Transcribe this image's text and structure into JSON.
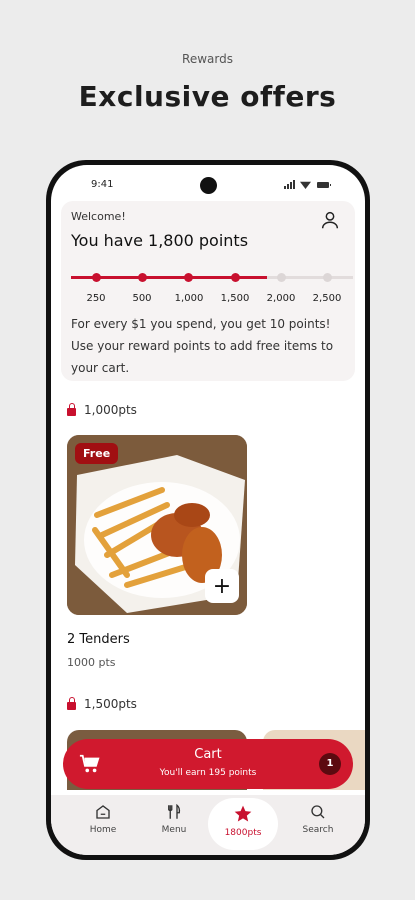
{
  "promo": {
    "eyebrow": "Rewards",
    "headline": "Exclusive offers"
  },
  "status_bar": {
    "time": "9:41"
  },
  "rewards_card": {
    "welcome": "Welcome!",
    "points_text": "You have 1,800 points",
    "progress": {
      "current_points": 1800,
      "reached_dots": 4,
      "total_dots": 6
    },
    "tick_labels": [
      "250",
      "500",
      "1,000",
      "1,500",
      "2,000",
      "2,500"
    ],
    "description": "For every $1 you spend, you get 10 points! Use your reward points to add free items to your cart."
  },
  "tiers": [
    {
      "label": "1,000pts",
      "items": [
        {
          "badge": "Free",
          "name": "2 Tenders",
          "points": "1000 pts",
          "add_label": "+"
        }
      ]
    },
    {
      "label": "1,500pts"
    }
  ],
  "cart": {
    "title": "Cart",
    "subtitle": "You'll earn 195 points",
    "count": "1"
  },
  "tab_bar": [
    {
      "label": "Home",
      "icon": "home-icon"
    },
    {
      "label": "Menu",
      "icon": "menu-icon"
    },
    {
      "label": "1800pts",
      "icon": "star-icon",
      "active": true
    },
    {
      "label": "Search",
      "icon": "search-icon"
    }
  ],
  "colors": {
    "accent": "#c8102e",
    "badge": "#a10f12",
    "cart_bg": "#d0192e"
  }
}
